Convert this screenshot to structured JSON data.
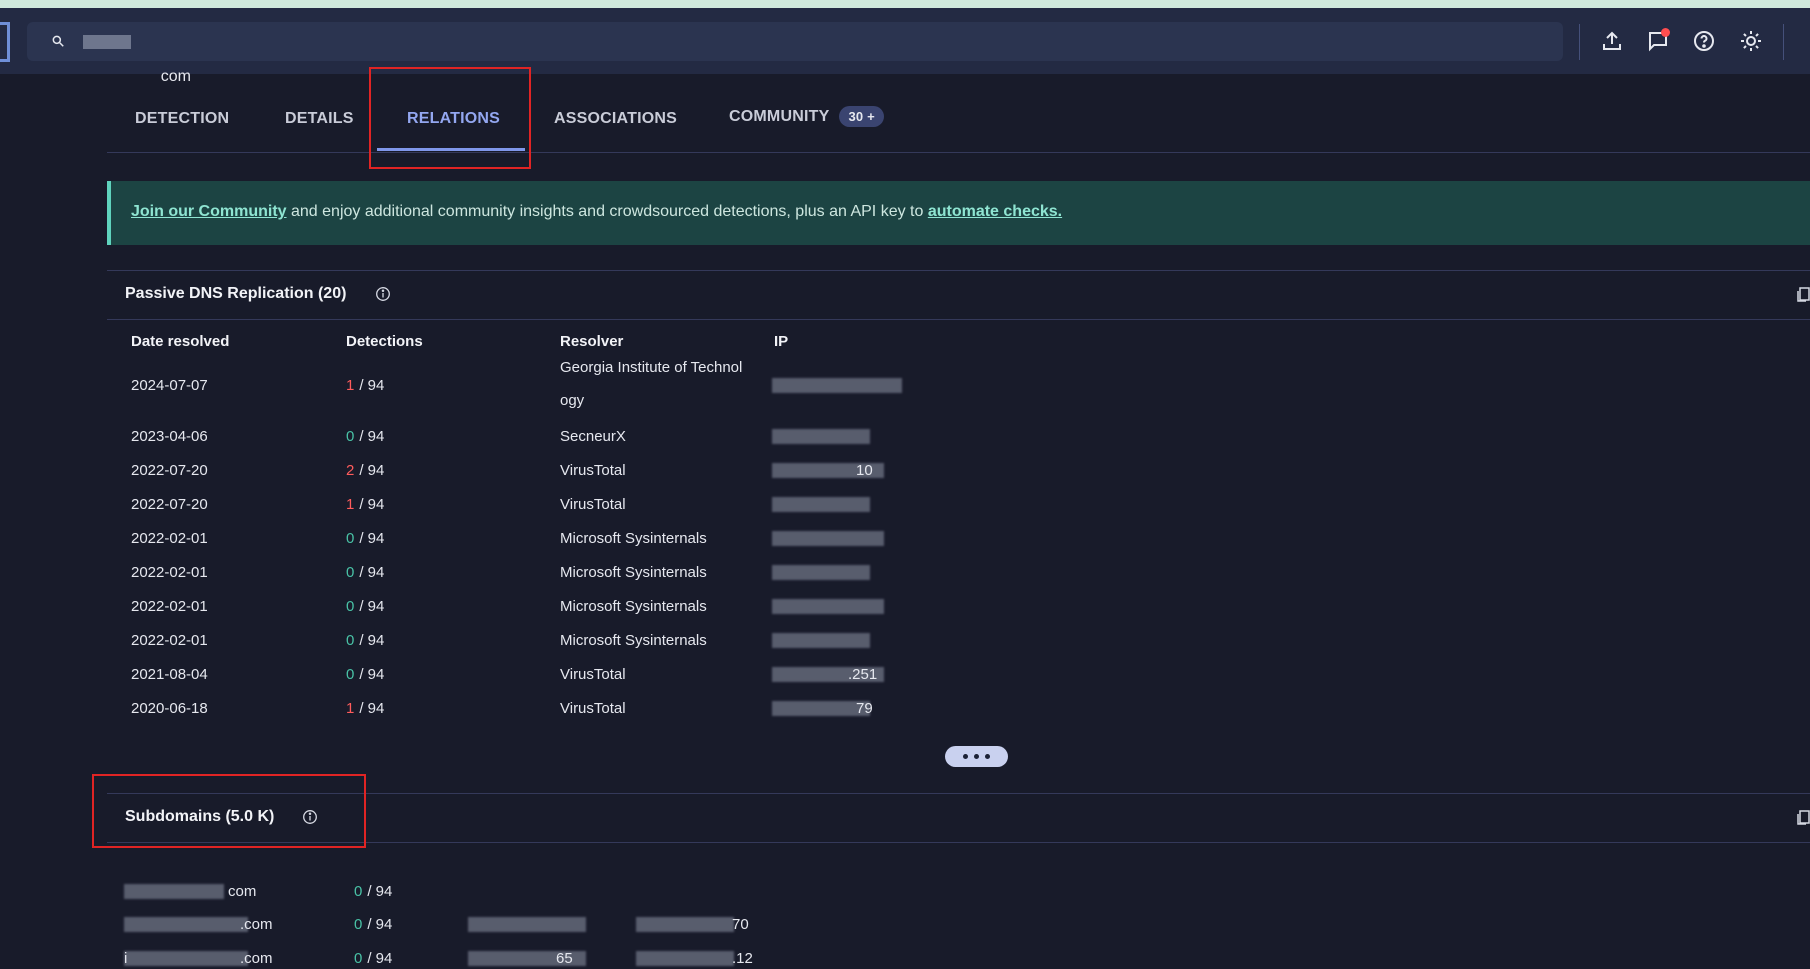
{
  "search": {
    "value": "com"
  },
  "tabs": [
    {
      "label": "DETECTION"
    },
    {
      "label": "DETAILS"
    },
    {
      "label": "RELATIONS"
    },
    {
      "label": "ASSOCIATIONS"
    },
    {
      "label": "COMMUNITY",
      "badge": "30 +"
    }
  ],
  "banner": {
    "link1": "Join our Community",
    "text": " and enjoy additional community insights and crowdsourced detections, plus an API key to ",
    "link2": "automate checks."
  },
  "passive_dns": {
    "title": "Passive DNS Replication  (20)",
    "headers": [
      "Date resolved",
      "Detections",
      "Resolver",
      "IP"
    ],
    "rows": [
      {
        "date": "2024-07-07",
        "det": "1",
        "total": "/ 94",
        "resolver_l1": "Georgia Institute of Technol",
        "resolver_l2": "ogy",
        "ip_tail": ""
      },
      {
        "date": "2023-04-06",
        "det": "0",
        "total": "/ 94",
        "resolver_l1": "SecneurX",
        "ip_tail": ""
      },
      {
        "date": "2022-07-20",
        "det": "2",
        "total": "/ 94",
        "resolver_l1": "VirusTotal",
        "ip_tail": "10"
      },
      {
        "date": "2022-07-20",
        "det": "1",
        "total": "/ 94",
        "resolver_l1": "VirusTotal",
        "ip_tail": ""
      },
      {
        "date": "2022-02-01",
        "det": "0",
        "total": "/ 94",
        "resolver_l1": "Microsoft Sysinternals",
        "ip_tail": ""
      },
      {
        "date": "2022-02-01",
        "det": "0",
        "total": "/ 94",
        "resolver_l1": "Microsoft Sysinternals",
        "ip_tail": ""
      },
      {
        "date": "2022-02-01",
        "det": "0",
        "total": "/ 94",
        "resolver_l1": "Microsoft Sysinternals",
        "ip_tail": ""
      },
      {
        "date": "2022-02-01",
        "det": "0",
        "total": "/ 94",
        "resolver_l1": "Microsoft Sysinternals",
        "ip_tail": ""
      },
      {
        "date": "2021-08-04",
        "det": "0",
        "total": "/ 94",
        "resolver_l1": "VirusTotal",
        "ip_tail": ".251"
      },
      {
        "date": "2020-06-18",
        "det": "1",
        "total": "/ 94",
        "resolver_l1": "VirusTotal",
        "ip_tail": "79"
      }
    ]
  },
  "subdomains": {
    "title": "Subdomains  (5.0 K)",
    "rows": [
      {
        "domain_tail": "com",
        "det": "0",
        "total": "/ 94",
        "ip1_tail": "",
        "ip2_tail": ""
      },
      {
        "domain_tail": ".com",
        "det": "0",
        "total": "/ 94",
        "ip1_tail": "",
        "ip2_tail": "70"
      },
      {
        "domain_head": "i",
        "domain_tail": ".com",
        "det": "0",
        "total": "/ 94",
        "ip1_tail": "65",
        "ip2_tail": ".12"
      }
    ]
  },
  "colors": {
    "accent": "#7f97ea",
    "bad": "#ff5c5c",
    "good": "#49c2a6",
    "banner_bg": "#1c4443"
  },
  "icons": [
    "search-icon",
    "upload-icon",
    "chat-icon",
    "help-icon",
    "theme-icon",
    "info-icon",
    "copy-icon"
  ]
}
